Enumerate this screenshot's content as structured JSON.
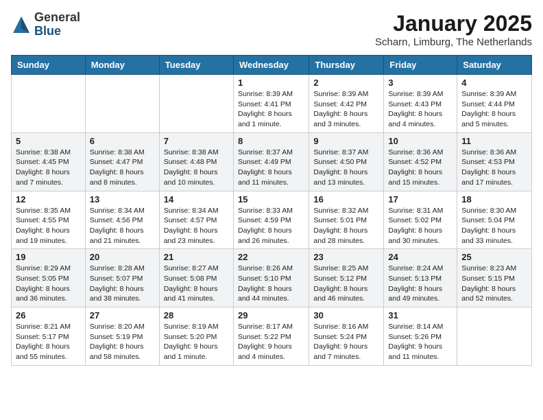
{
  "header": {
    "logo": {
      "general": "General",
      "blue": "Blue"
    },
    "title": "January 2025",
    "location": "Scharn, Limburg, The Netherlands"
  },
  "days_of_week": [
    "Sunday",
    "Monday",
    "Tuesday",
    "Wednesday",
    "Thursday",
    "Friday",
    "Saturday"
  ],
  "weeks": [
    [
      {
        "day": "",
        "info": ""
      },
      {
        "day": "",
        "info": ""
      },
      {
        "day": "",
        "info": ""
      },
      {
        "day": "1",
        "info": "Sunrise: 8:39 AM\nSunset: 4:41 PM\nDaylight: 8 hours and 1 minute."
      },
      {
        "day": "2",
        "info": "Sunrise: 8:39 AM\nSunset: 4:42 PM\nDaylight: 8 hours and 3 minutes."
      },
      {
        "day": "3",
        "info": "Sunrise: 8:39 AM\nSunset: 4:43 PM\nDaylight: 8 hours and 4 minutes."
      },
      {
        "day": "4",
        "info": "Sunrise: 8:39 AM\nSunset: 4:44 PM\nDaylight: 8 hours and 5 minutes."
      }
    ],
    [
      {
        "day": "5",
        "info": "Sunrise: 8:38 AM\nSunset: 4:45 PM\nDaylight: 8 hours and 7 minutes."
      },
      {
        "day": "6",
        "info": "Sunrise: 8:38 AM\nSunset: 4:47 PM\nDaylight: 8 hours and 8 minutes."
      },
      {
        "day": "7",
        "info": "Sunrise: 8:38 AM\nSunset: 4:48 PM\nDaylight: 8 hours and 10 minutes."
      },
      {
        "day": "8",
        "info": "Sunrise: 8:37 AM\nSunset: 4:49 PM\nDaylight: 8 hours and 11 minutes."
      },
      {
        "day": "9",
        "info": "Sunrise: 8:37 AM\nSunset: 4:50 PM\nDaylight: 8 hours and 13 minutes."
      },
      {
        "day": "10",
        "info": "Sunrise: 8:36 AM\nSunset: 4:52 PM\nDaylight: 8 hours and 15 minutes."
      },
      {
        "day": "11",
        "info": "Sunrise: 8:36 AM\nSunset: 4:53 PM\nDaylight: 8 hours and 17 minutes."
      }
    ],
    [
      {
        "day": "12",
        "info": "Sunrise: 8:35 AM\nSunset: 4:55 PM\nDaylight: 8 hours and 19 minutes."
      },
      {
        "day": "13",
        "info": "Sunrise: 8:34 AM\nSunset: 4:56 PM\nDaylight: 8 hours and 21 minutes."
      },
      {
        "day": "14",
        "info": "Sunrise: 8:34 AM\nSunset: 4:57 PM\nDaylight: 8 hours and 23 minutes."
      },
      {
        "day": "15",
        "info": "Sunrise: 8:33 AM\nSunset: 4:59 PM\nDaylight: 8 hours and 26 minutes."
      },
      {
        "day": "16",
        "info": "Sunrise: 8:32 AM\nSunset: 5:01 PM\nDaylight: 8 hours and 28 minutes."
      },
      {
        "day": "17",
        "info": "Sunrise: 8:31 AM\nSunset: 5:02 PM\nDaylight: 8 hours and 30 minutes."
      },
      {
        "day": "18",
        "info": "Sunrise: 8:30 AM\nSunset: 5:04 PM\nDaylight: 8 hours and 33 minutes."
      }
    ],
    [
      {
        "day": "19",
        "info": "Sunrise: 8:29 AM\nSunset: 5:05 PM\nDaylight: 8 hours and 36 minutes."
      },
      {
        "day": "20",
        "info": "Sunrise: 8:28 AM\nSunset: 5:07 PM\nDaylight: 8 hours and 38 minutes."
      },
      {
        "day": "21",
        "info": "Sunrise: 8:27 AM\nSunset: 5:08 PM\nDaylight: 8 hours and 41 minutes."
      },
      {
        "day": "22",
        "info": "Sunrise: 8:26 AM\nSunset: 5:10 PM\nDaylight: 8 hours and 44 minutes."
      },
      {
        "day": "23",
        "info": "Sunrise: 8:25 AM\nSunset: 5:12 PM\nDaylight: 8 hours and 46 minutes."
      },
      {
        "day": "24",
        "info": "Sunrise: 8:24 AM\nSunset: 5:13 PM\nDaylight: 8 hours and 49 minutes."
      },
      {
        "day": "25",
        "info": "Sunrise: 8:23 AM\nSunset: 5:15 PM\nDaylight: 8 hours and 52 minutes."
      }
    ],
    [
      {
        "day": "26",
        "info": "Sunrise: 8:21 AM\nSunset: 5:17 PM\nDaylight: 8 hours and 55 minutes."
      },
      {
        "day": "27",
        "info": "Sunrise: 8:20 AM\nSunset: 5:19 PM\nDaylight: 8 hours and 58 minutes."
      },
      {
        "day": "28",
        "info": "Sunrise: 8:19 AM\nSunset: 5:20 PM\nDaylight: 9 hours and 1 minute."
      },
      {
        "day": "29",
        "info": "Sunrise: 8:17 AM\nSunset: 5:22 PM\nDaylight: 9 hours and 4 minutes."
      },
      {
        "day": "30",
        "info": "Sunrise: 8:16 AM\nSunset: 5:24 PM\nDaylight: 9 hours and 7 minutes."
      },
      {
        "day": "31",
        "info": "Sunrise: 8:14 AM\nSunset: 5:26 PM\nDaylight: 9 hours and 11 minutes."
      },
      {
        "day": "",
        "info": ""
      }
    ]
  ]
}
